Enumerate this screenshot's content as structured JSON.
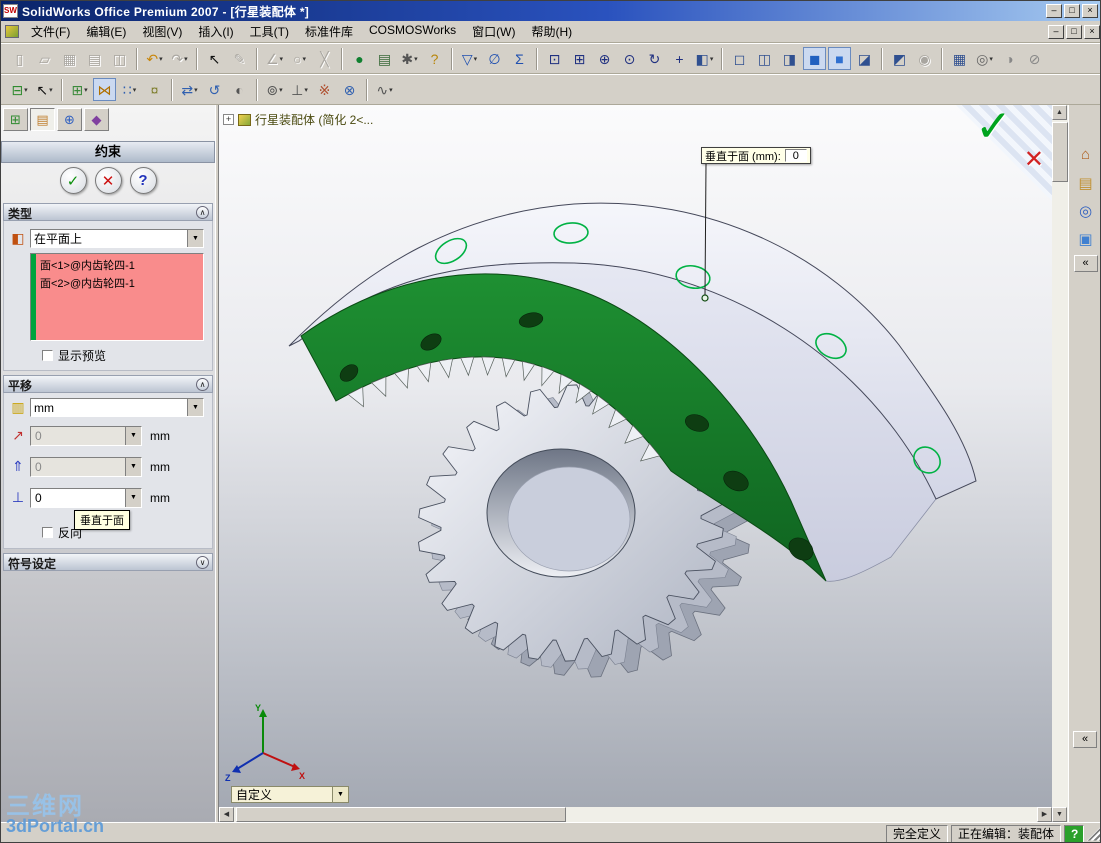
{
  "window": {
    "title": "SolidWorks Office Premium 2007 - [行星装配体 *]",
    "app_icon": "SW",
    "controls": {
      "minimize": "–",
      "restore": "□",
      "close": "×"
    }
  },
  "menubar": {
    "items": [
      {
        "name": "menu-file",
        "label": "文件(F)"
      },
      {
        "name": "menu-edit",
        "label": "编辑(E)"
      },
      {
        "name": "menu-view",
        "label": "视图(V)"
      },
      {
        "name": "menu-insert",
        "label": "插入(I)"
      },
      {
        "name": "menu-tools",
        "label": "工具(T)"
      },
      {
        "name": "menu-standard-parts",
        "label": "标准件库"
      },
      {
        "name": "menu-cosmosworks",
        "label": "COSMOSWorks"
      },
      {
        "name": "menu-window",
        "label": "窗口(W)"
      },
      {
        "name": "menu-help",
        "label": "帮助(H)"
      }
    ],
    "controls": {
      "minimize": "–",
      "restore": "□",
      "close": "×"
    }
  },
  "glyphs": {
    "dropdown": "▼"
  },
  "toolbar_standard": [
    {
      "name": "new-document",
      "glyph": "▯",
      "color": "#666666",
      "disabled": true
    },
    {
      "name": "open-document",
      "glyph": "▱",
      "color": "#8a7a40",
      "disabled": true
    },
    {
      "name": "save",
      "glyph": "▦",
      "color": "#4a5a8a",
      "disabled": true
    },
    {
      "name": "print",
      "glyph": "▤",
      "color": "#555555",
      "disabled": true
    },
    {
      "name": "print-preview",
      "glyph": "◫",
      "color": "#555555",
      "disabled": true
    },
    {
      "sep": true
    },
    {
      "name": "undo",
      "glyph": "↶",
      "color": "#C8860B",
      "dropdown": true
    },
    {
      "name": "redo",
      "glyph": "↷",
      "color": "#777777",
      "disabled": true,
      "dropdown": true
    },
    {
      "sep": true
    },
    {
      "name": "select",
      "glyph": "↖",
      "color": "#111111"
    },
    {
      "name": "sketch",
      "glyph": "✎",
      "color": "#777777",
      "disabled": true
    },
    {
      "sep": true
    },
    {
      "name": "smart-dimension",
      "glyph": "∠",
      "color": "#777777",
      "disabled": true,
      "dropdown": true
    },
    {
      "name": "sketch-entities",
      "glyph": "○",
      "color": "#777777",
      "disabled": true,
      "dropdown": true
    },
    {
      "name": "trim-entities",
      "glyph": "╳",
      "color": "#777777",
      "disabled": true
    },
    {
      "sep": true
    },
    {
      "name": "rebuild",
      "glyph": "●",
      "color": "#108030"
    },
    {
      "name": "file-properties",
      "glyph": "▤",
      "color": "#3a6a3a"
    },
    {
      "name": "options",
      "glyph": "✱",
      "color": "#555555",
      "dropdown": true
    },
    {
      "name": "help",
      "glyph": "?",
      "color": "#B8860B"
    },
    {
      "sep": true
    },
    {
      "name": "selection-filter",
      "glyph": "▽",
      "color": "#2050B0",
      "dropdown": true
    },
    {
      "name": "measure",
      "glyph": "∅",
      "color": "#2050B0"
    },
    {
      "name": "mass-properties",
      "glyph": "Σ",
      "color": "#2050B0"
    },
    {
      "sep": true
    },
    {
      "name": "zoom-to-fit",
      "glyph": "⊡",
      "color": "#203080"
    },
    {
      "name": "zoom-to-area",
      "glyph": "⊞",
      "color": "#203080"
    },
    {
      "name": "zoom-in-out",
      "glyph": "⊕",
      "color": "#203080"
    },
    {
      "name": "zoom-to-selection",
      "glyph": "⊙",
      "color": "#203080"
    },
    {
      "name": "rotate-view",
      "glyph": "↻",
      "color": "#203080"
    },
    {
      "name": "pan",
      "glyph": "+",
      "color": "#203080"
    },
    {
      "name": "standard-views",
      "glyph": "◧",
      "color": "#305090",
      "dropdown": true
    },
    {
      "sep": true
    },
    {
      "name": "wireframe",
      "glyph": "◻",
      "color": "#305090"
    },
    {
      "name": "hidden-lines-visible",
      "glyph": "◫",
      "color": "#305090"
    },
    {
      "name": "hidden-lines-removed",
      "glyph": "◨",
      "color": "#305090"
    },
    {
      "name": "shaded-with-edges",
      "glyph": "◼",
      "color": "#2060C0",
      "pressed": true
    },
    {
      "name": "shaded",
      "glyph": "■",
      "color": "#3070D0",
      "pressed": true
    },
    {
      "name": "shadows-in-shaded-mode",
      "glyph": "◪",
      "color": "#305090"
    },
    {
      "sep": true
    },
    {
      "name": "section-view",
      "glyph": "◩",
      "color": "#305090"
    },
    {
      "name": "realview-graphics",
      "glyph": "◉",
      "color": "#888888",
      "disabled": true
    },
    {
      "sep": true
    },
    {
      "name": "view-orientation",
      "glyph": "▦",
      "color": "#305090"
    },
    {
      "name": "apply-scene",
      "glyph": "◎",
      "color": "#666666",
      "dropdown": true
    },
    {
      "name": "edit-color",
      "glyph": "◑",
      "color": "#888888"
    },
    {
      "name": "toggle-display",
      "glyph": "⊘",
      "color": "#888888"
    }
  ],
  "toolbar_assembly": [
    {
      "name": "featuremanager-flyout",
      "glyph": "⊟",
      "color": "#2E8B2E",
      "dropdown": true
    },
    {
      "name": "select-flyout",
      "glyph": "↖",
      "color": "#111111",
      "dropdown": true
    },
    {
      "sep": true
    },
    {
      "name": "insert-component",
      "glyph": "⊞",
      "color": "#3a8a3a",
      "dropdown": true
    },
    {
      "name": "mate",
      "glyph": "⋈",
      "color": "#B07000",
      "pressed": true
    },
    {
      "name": "linear-component-pattern",
      "glyph": "∷",
      "color": "#3060B0",
      "dropdown": true
    },
    {
      "name": "smart-fasteners",
      "glyph": "¤",
      "color": "#808030"
    },
    {
      "sep": true
    },
    {
      "name": "move-component",
      "glyph": "⇄",
      "color": "#3060B0",
      "dropdown": true
    },
    {
      "name": "rotate-component",
      "glyph": "↺",
      "color": "#3060B0"
    },
    {
      "name": "show-hidden-components",
      "glyph": "◐",
      "color": "#555555"
    },
    {
      "sep": true
    },
    {
      "name": "assembly-features",
      "glyph": "⊚",
      "color": "#555555",
      "dropdown": true
    },
    {
      "name": "reference-geometry",
      "glyph": "⊥",
      "color": "#555555",
      "dropdown": true
    },
    {
      "name": "exploded-view",
      "glyph": "※",
      "color": "#B05030"
    },
    {
      "name": "interference-detection",
      "glyph": "⊗",
      "color": "#3060B0"
    },
    {
      "sep": true
    },
    {
      "name": "simulation",
      "glyph": "∿",
      "color": "#555555",
      "dropdown": true
    }
  ],
  "panel_tabs": [
    {
      "name": "featuremanager-tab",
      "glyph": "⊞",
      "color": "#2E8B2E"
    },
    {
      "name": "propertymanager-tab",
      "glyph": "▤",
      "color": "#C08030",
      "active": true
    },
    {
      "name": "configurationmanager-tab",
      "glyph": "⊕",
      "color": "#3060C0"
    },
    {
      "name": "dimxpert-tab",
      "glyph": "◆",
      "color": "#8040A0"
    }
  ],
  "property_manager": {
    "title": "约束",
    "ok_glyph": "✓",
    "cancel_glyph": "✕",
    "help_glyph": "?",
    "collapse_glyph": "∧",
    "expand_glyph": "∨",
    "type_section": {
      "header": "类型",
      "icon_glyph": "◧",
      "selected_type": "在平面上",
      "selection_items": [
        "面<1>@内齿轮四-1",
        "面<2>@内齿轮四-1"
      ],
      "preview_label": "显示预览"
    },
    "translate_section": {
      "header": "平移",
      "ruler_glyph": "▥",
      "unit": "mm",
      "fields": [
        {
          "name": "delta-x",
          "glyph": "↗",
          "value": "0",
          "unit": "mm"
        },
        {
          "name": "delta-y",
          "glyph": "⇑",
          "value": "0",
          "unit": "mm"
        },
        {
          "name": "normal-distance",
          "glyph": "⊥",
          "value": "0",
          "unit": "mm"
        }
      ],
      "tooltip": "垂直于面",
      "reverse_label": "反向"
    },
    "symbol_section": {
      "header": "符号设定"
    }
  },
  "viewport": {
    "feature_tree": {
      "expander": "+",
      "label": "行星装配体 (简化 2<..."
    },
    "callout": {
      "label": "垂直于面 (mm):",
      "value": "0"
    },
    "view_combo": {
      "value": "自定义"
    },
    "triad": {
      "x": "X",
      "y": "Y",
      "z": "Z"
    },
    "colors": {
      "selected_face": "#17822A",
      "hole_dark": "#0E3D12",
      "edge_green": "#00B244",
      "gear_light": "#EDEFF6",
      "gear_shadow": "#9EA4B2"
    }
  },
  "confirmation_corner": {
    "ok_glyph": "✓",
    "cancel_glyph": "✕"
  },
  "taskpane": {
    "icons": [
      {
        "name": "solidworks-resources",
        "glyph": "⌂",
        "color": "#B06020"
      },
      {
        "name": "design-library",
        "glyph": "▤",
        "color": "#C09030"
      },
      {
        "name": "file-explorer",
        "glyph": "◎",
        "color": "#3060C0"
      },
      {
        "name": "view-palette",
        "glyph": "▣",
        "color": "#4080D0"
      }
    ],
    "collapse_glyph": "«"
  },
  "statusbar": {
    "fully_defined": "完全定义",
    "editing": "正在编辑：装配体",
    "help_glyph": "?"
  },
  "watermark": {
    "line1": "三维网",
    "line2": "3dPortal.cn"
  },
  "scrollbars": {
    "up": "▲",
    "down": "▼",
    "left": "◀",
    "right": "▶"
  }
}
